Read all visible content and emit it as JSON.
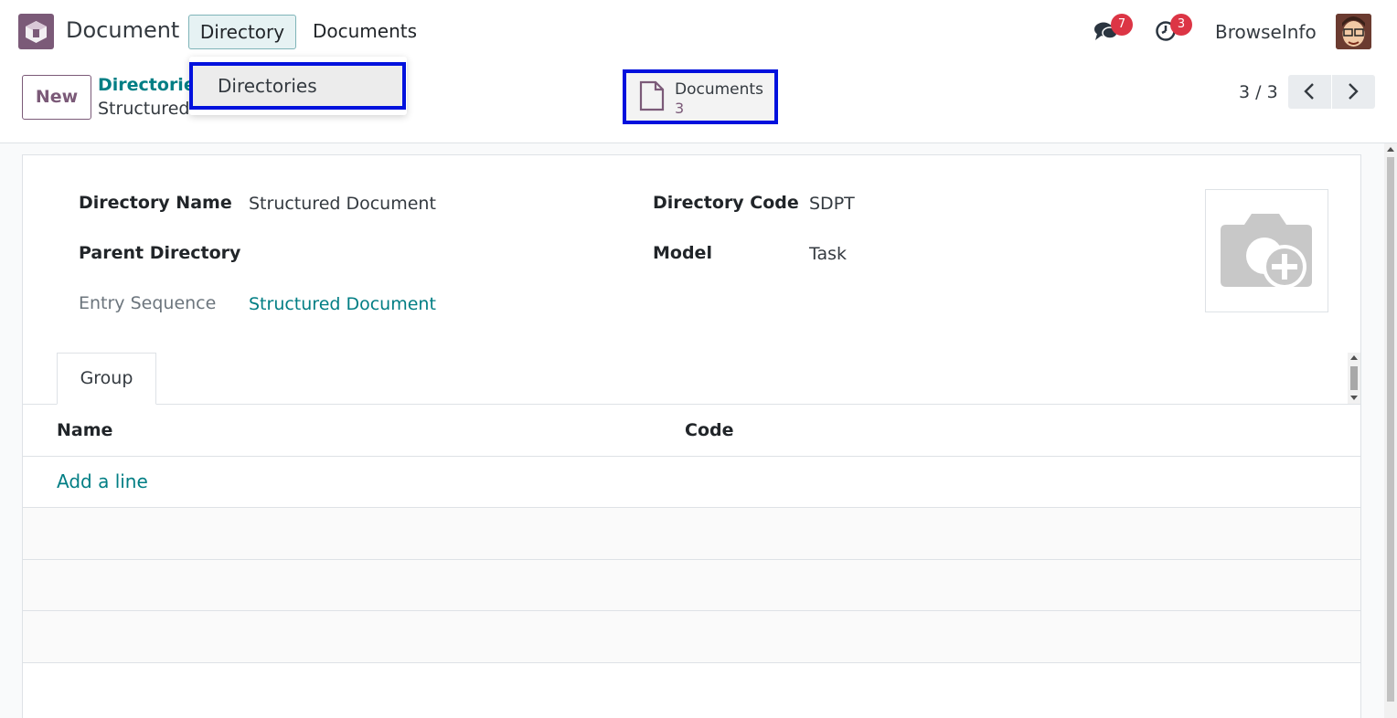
{
  "navbar": {
    "app_name": "Document",
    "menu": [
      "Directory",
      "Documents"
    ],
    "chat_count": "7",
    "activity_count": "3",
    "user_name": "BrowseInfo"
  },
  "dropdown": {
    "items": [
      "Directories"
    ]
  },
  "control_panel": {
    "new_label": "New",
    "breadcrumb_parent": "Directories",
    "breadcrumb_current": "Structured Document",
    "smart_button": {
      "label": "Documents",
      "count": "3"
    },
    "pager": "3 / 3"
  },
  "form": {
    "directory_name_label": "Directory Name",
    "directory_name_value": "Structured Document",
    "parent_directory_label": "Parent Directory",
    "entry_sequence_label": "Entry Sequence",
    "entry_sequence_value": "Structured Document",
    "directory_code_label": "Directory Code",
    "directory_code_value": "SDPT",
    "model_label": "Model",
    "model_value": "Task"
  },
  "notebook": {
    "tabs": [
      "Group"
    ],
    "columns": [
      "Name",
      "Code"
    ],
    "add_line": "Add a line"
  },
  "colors": {
    "brand": "#7b5a78",
    "link": "#017e84",
    "highlight": "#0011dd",
    "badge": "#dc3545"
  }
}
